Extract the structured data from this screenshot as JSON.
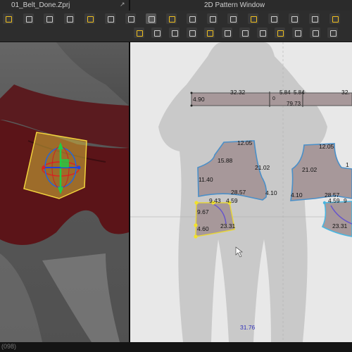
{
  "window": {
    "project_title": "01_Belt_Done.Zprj",
    "pattern_title": "2D Pattern Window",
    "status_text": "(098)"
  },
  "toolbar": {
    "row1_icons": [
      "select-icon",
      "transform-icon",
      "lasso-icon",
      "pin-icon",
      "fold-icon",
      "arrange-icon",
      "rotate-icon",
      "move-icon",
      "point-icon",
      "segment-icon",
      "edit-curve-icon",
      "curve-point-icon",
      "polygon-icon",
      "rectangle-icon",
      "circle-icon",
      "internal-shape-icon",
      "gear-icon"
    ],
    "row2_icons": [
      "sew-icon",
      "free-sew-icon",
      "segment-sew-icon",
      "tuck-icon",
      "fold-arrange-icon",
      "avatar-icon",
      "garment-icon",
      "button-icon",
      "zipper-icon",
      "grain-icon",
      "fabric-icon",
      "highlight-icon"
    ]
  },
  "pattern": {
    "belt_left_label": "4.90",
    "belt_top_label": "32.32",
    "belt_mid_labels": [
      "5.84",
      "5.84"
    ],
    "belt_mid_small": "0",
    "belt_bottom_label": "79.73",
    "belt_right_label": "32.",
    "left_piece": {
      "top": "12.05",
      "inner": "15.88",
      "side": "11.40",
      "mid": "21.02",
      "bottom": "28.57",
      "corner": "4.10"
    },
    "right_piece": {
      "top": "12.05",
      "side": "4.10",
      "mid": "21.02",
      "bottom": "28.57",
      "edge": "1"
    },
    "left_pocket": {
      "top_a": "9.43",
      "top_b": "4.59",
      "side": "9.67",
      "bottom": "4.60",
      "curve": "23.31"
    },
    "right_pocket": {
      "top": "4.59",
      "top_b": "9",
      "curve": "23.31"
    },
    "bottom_measure": "31.76"
  }
}
